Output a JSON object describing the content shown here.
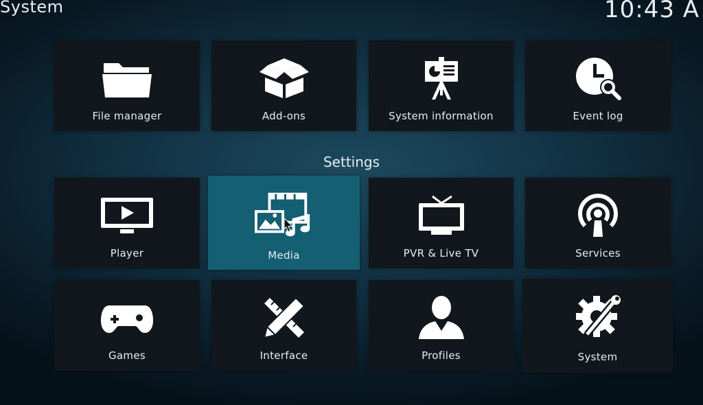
{
  "header": {
    "title": "System",
    "clock": "10:43 A"
  },
  "section_label": "Settings",
  "tiles": [
    {
      "label": "File manager",
      "icon": "folder-icon"
    },
    {
      "label": "Add-ons",
      "icon": "open-box-icon"
    },
    {
      "label": "System information",
      "icon": "presentation-board-icon"
    },
    {
      "label": "Event log",
      "icon": "clock-search-icon"
    },
    {
      "label": "Player",
      "icon": "play-monitor-icon"
    },
    {
      "label": "Media",
      "icon": "media-library-icon"
    },
    {
      "label": "PVR & Live TV",
      "icon": "tv-antenna-icon"
    },
    {
      "label": "Services",
      "icon": "broadcast-icon"
    },
    {
      "label": "Games",
      "icon": "gamepad-icon"
    },
    {
      "label": "Interface",
      "icon": "pencil-ruler-icon"
    },
    {
      "label": "Profiles",
      "icon": "user-profile-icon"
    },
    {
      "label": "System",
      "icon": "gear-wrench-icon"
    }
  ],
  "colors": {
    "tile_bg": "#11171c",
    "focused_bg": "#145f72"
  }
}
